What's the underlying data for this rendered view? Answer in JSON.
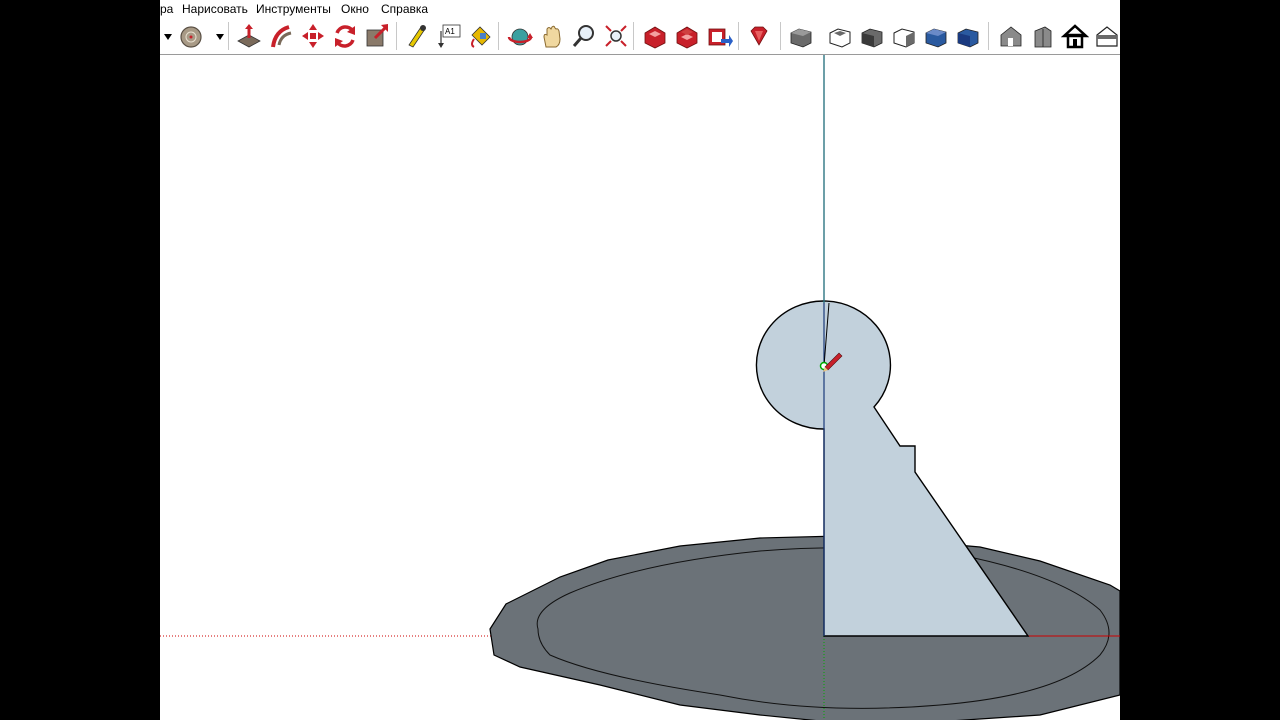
{
  "menu": {
    "items": [
      "ра",
      "Нарисовать",
      "Инструменты",
      "Окно",
      "Справка"
    ]
  },
  "toolbar": {
    "buttons": [
      {
        "icon": "dropdown-arrow-icon"
      },
      {
        "icon": "circle-icon"
      },
      {
        "icon": "dropdown-arrow-icon"
      },
      {
        "icon": "push-pull-icon"
      },
      {
        "icon": "follow-me-icon"
      },
      {
        "icon": "move-icon"
      },
      {
        "icon": "rotate-icon"
      },
      {
        "icon": "scale-icon"
      },
      {
        "icon": "tape-measure-icon"
      },
      {
        "icon": "text-icon",
        "label": "A1"
      },
      {
        "icon": "paint-bucket-icon"
      },
      {
        "icon": "orbit-icon"
      },
      {
        "icon": "pan-icon"
      },
      {
        "icon": "zoom-icon"
      },
      {
        "icon": "zoom-extents-icon"
      },
      {
        "icon": "3d-warehouse-icon"
      },
      {
        "icon": "get-models-icon"
      },
      {
        "icon": "share-model-icon"
      },
      {
        "icon": "ruby-console-icon"
      },
      {
        "icon": "iso-view-icon"
      },
      {
        "icon": "top-view-icon"
      },
      {
        "icon": "front-view-icon"
      },
      {
        "icon": "right-view-icon"
      },
      {
        "icon": "back-view-icon"
      },
      {
        "icon": "left-view-icon"
      },
      {
        "icon": "house-iso-icon"
      },
      {
        "icon": "house-side-icon"
      },
      {
        "icon": "home-icon"
      },
      {
        "icon": "house-section-icon"
      }
    ]
  },
  "colors": {
    "face_front": "#c2d1dc",
    "face_ground": "#6b7278",
    "edge": "#000000",
    "axis_red": "#cc0000",
    "axis_green": "#00aa00",
    "axis_blue": "#0000cc",
    "toolbar_accent": "#c8202a"
  }
}
